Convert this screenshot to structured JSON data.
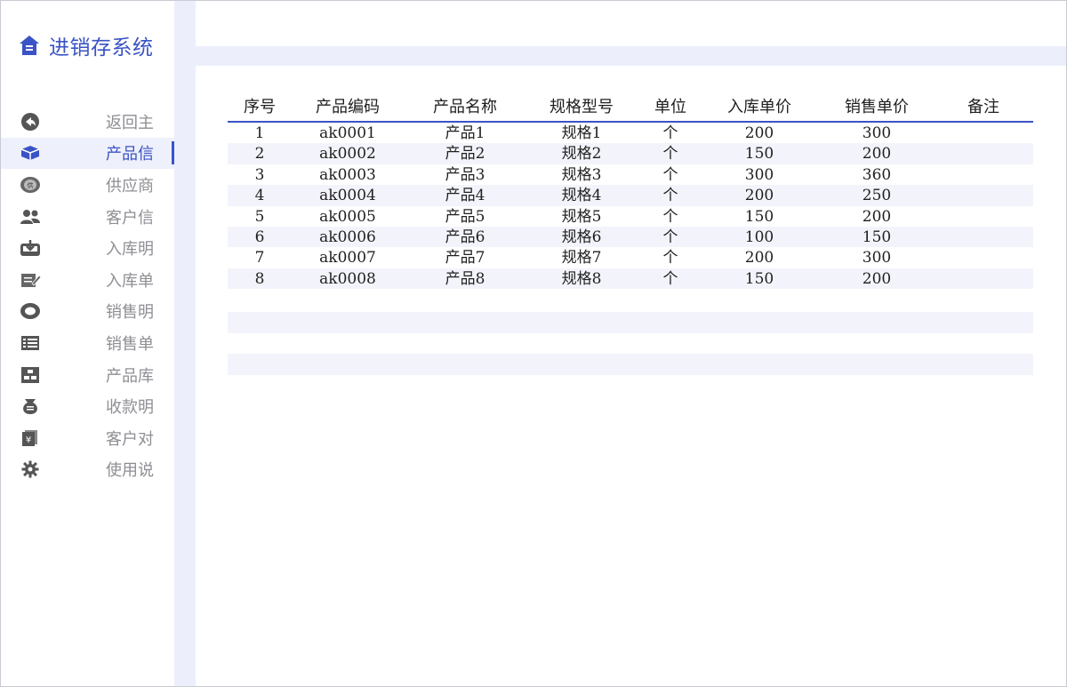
{
  "app": {
    "title": "进销存系统",
    "accent_color": "#3a53c5"
  },
  "sidebar": {
    "items": [
      {
        "label": "返回主",
        "icon": "back-arrow-icon",
        "active": false
      },
      {
        "label": "产品信",
        "icon": "box-icon",
        "active": true
      },
      {
        "label": "供应商",
        "icon": "supplier-badge-icon",
        "active": false
      },
      {
        "label": "客户信",
        "icon": "users-icon",
        "active": false
      },
      {
        "label": "入库明",
        "icon": "inbox-download-icon",
        "active": false
      },
      {
        "label": "入库单",
        "icon": "edit-form-icon",
        "active": false
      },
      {
        "label": "销售明",
        "icon": "tag-icon",
        "active": false
      },
      {
        "label": "销售单",
        "icon": "list-icon",
        "active": false
      },
      {
        "label": "产品库",
        "icon": "warehouse-icon",
        "active": false
      },
      {
        "label": "收款明",
        "icon": "money-bag-icon",
        "active": false
      },
      {
        "label": "客户对",
        "icon": "yen-document-icon",
        "active": false
      },
      {
        "label": "使用说",
        "icon": "gear-icon",
        "active": false
      }
    ]
  },
  "table": {
    "headers": [
      "序号",
      "产品编码",
      "产品名称",
      "规格型号",
      "单位",
      "入库单价",
      "销售单价",
      "备注"
    ],
    "rows": [
      [
        "1",
        "ak0001",
        "产品1",
        "规格1",
        "个",
        "200",
        "300",
        ""
      ],
      [
        "2",
        "ak0002",
        "产品2",
        "规格2",
        "个",
        "150",
        "200",
        ""
      ],
      [
        "3",
        "ak0003",
        "产品3",
        "规格3",
        "个",
        "300",
        "360",
        ""
      ],
      [
        "4",
        "ak0004",
        "产品4",
        "规格4",
        "个",
        "200",
        "250",
        ""
      ],
      [
        "5",
        "ak0005",
        "产品5",
        "规格5",
        "个",
        "150",
        "200",
        ""
      ],
      [
        "6",
        "ak0006",
        "产品6",
        "规格6",
        "个",
        "100",
        "150",
        ""
      ],
      [
        "7",
        "ak0007",
        "产品7",
        "规格7",
        "个",
        "200",
        "300",
        ""
      ],
      [
        "8",
        "ak0008",
        "产品8",
        "规格8",
        "个",
        "150",
        "200",
        ""
      ]
    ]
  }
}
